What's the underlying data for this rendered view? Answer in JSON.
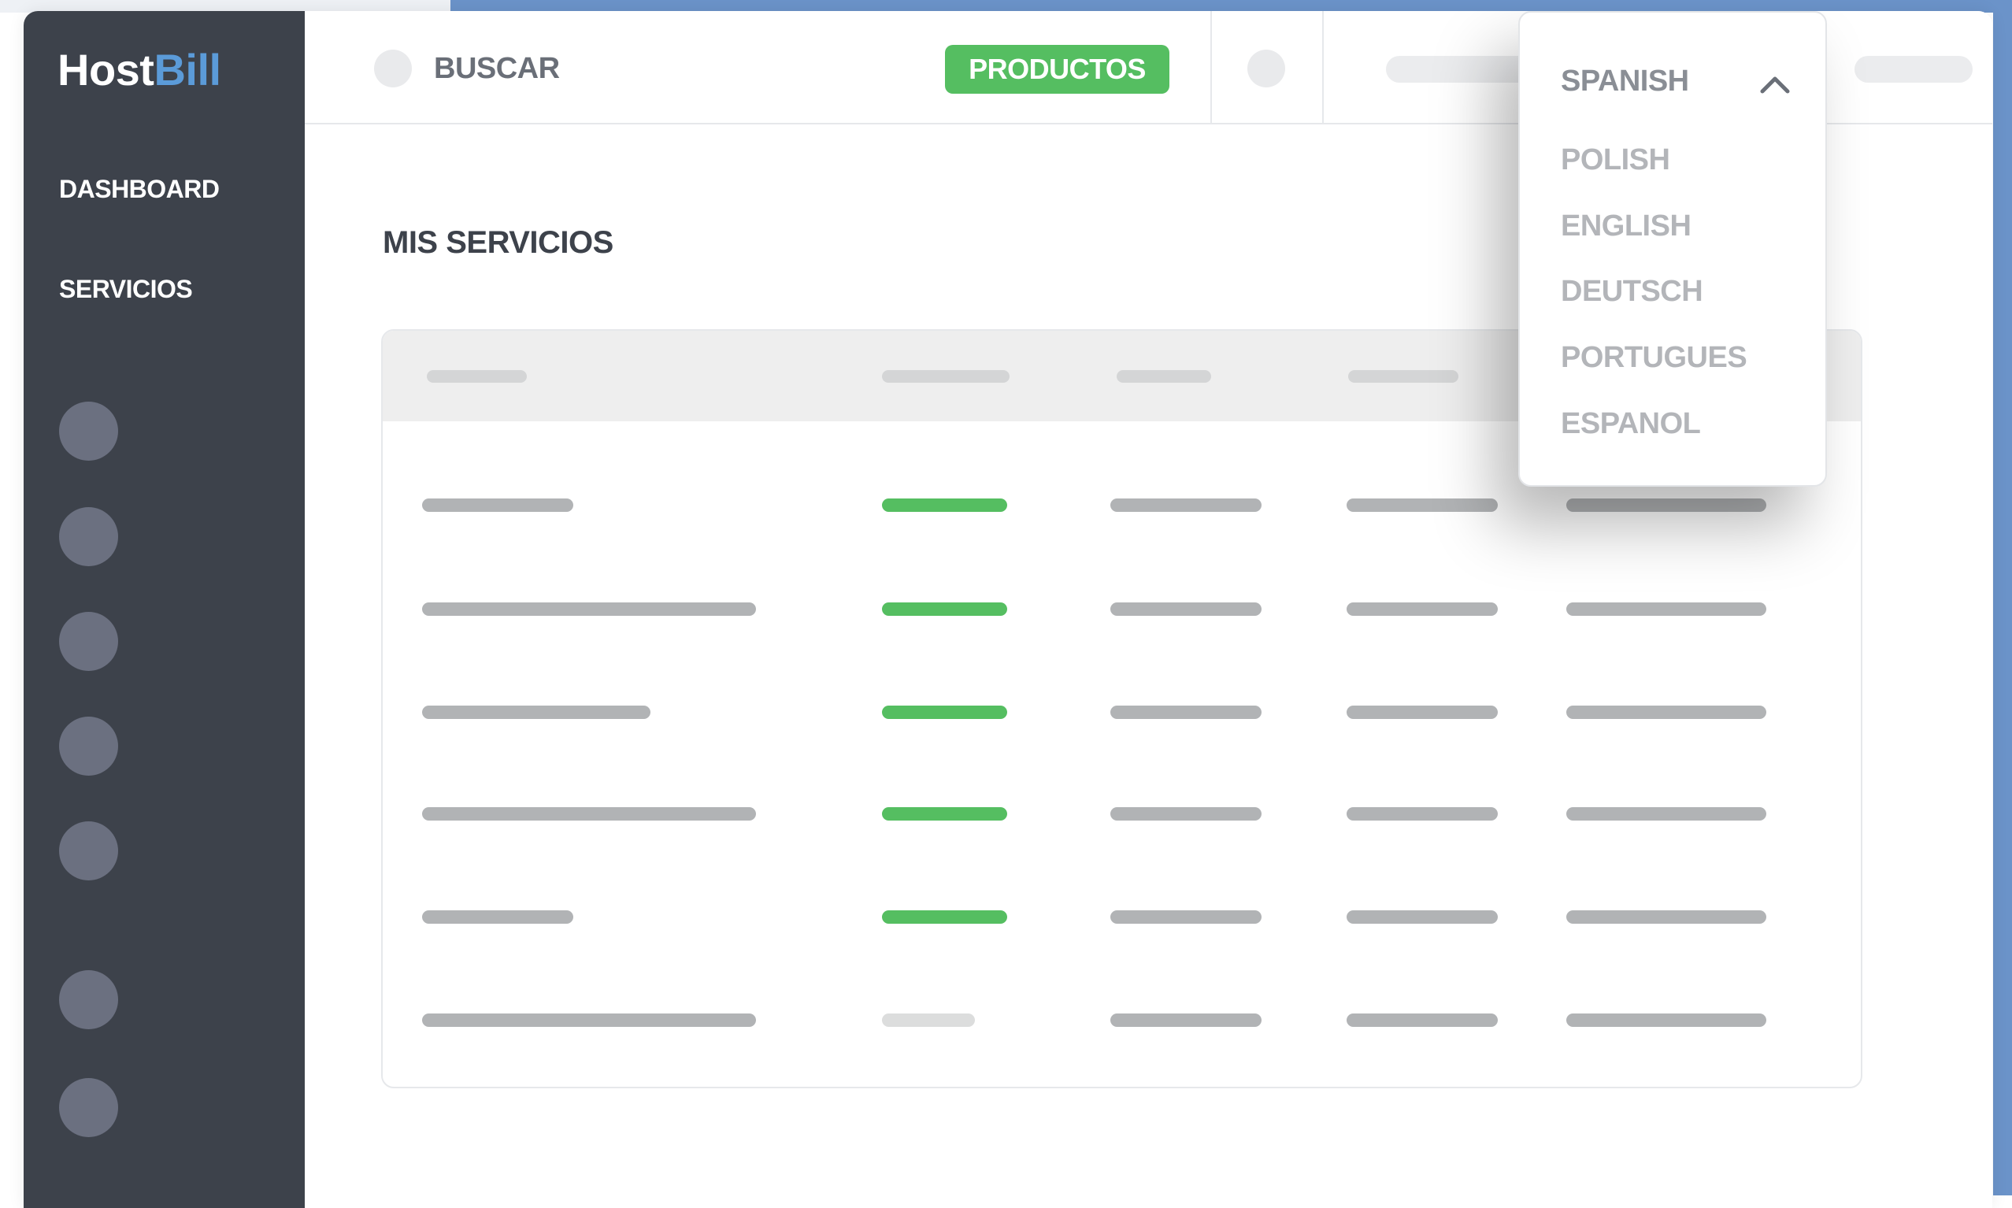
{
  "brand": {
    "logo_part1": "Host",
    "logo_part2": "Bill",
    "accent_color": "#5b9bd9"
  },
  "sidebar": {
    "items": [
      {
        "label": "DASHBOARD"
      },
      {
        "label": "SERVICIOS"
      }
    ],
    "icons": [
      "nav-icon",
      "nav-icon",
      "nav-icon",
      "nav-icon",
      "nav-icon",
      "nav-icon",
      "nav-icon"
    ],
    "background": "#3d424b"
  },
  "header": {
    "search_label": "BUSCAR",
    "productos_label": "PRODUCTOS",
    "productos_color": "#55be61"
  },
  "main": {
    "title": "MIS SERVICIOS",
    "table": {
      "rows": 6,
      "status_colors": [
        "green",
        "green",
        "green",
        "green",
        "green",
        "light"
      ]
    }
  },
  "language_dropdown": {
    "selected": "SPANISH",
    "open": true,
    "options": [
      "POLISH",
      "ENGLISH",
      "DEUTSCH",
      "PORTUGUES",
      "ESPANOL"
    ]
  }
}
